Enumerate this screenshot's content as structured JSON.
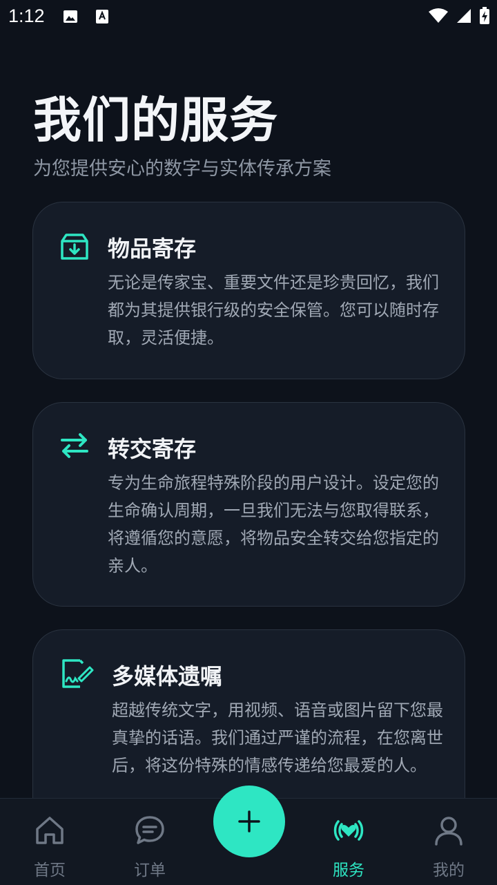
{
  "status": {
    "time": "1:12"
  },
  "page": {
    "title": "我们的服务",
    "subtitle": "为您提供安心的数字与实体传承方案"
  },
  "services": [
    {
      "title": "物品寄存",
      "body": "无论是传家宝、重要文件还是珍贵回忆，我们都为其提供银行级的安全保管。您可以随时存取，灵活便捷。",
      "icon": "archive-download-icon"
    },
    {
      "title": "转交寄存",
      "body": "专为生命旅程特殊阶段的用户设计。设定您的生命确认周期，一旦我们无法与您取得联系，将遵循您的意愿，将物品安全转交给您指定的亲人。",
      "icon": "transfer-arrows-icon"
    },
    {
      "title": "多媒体遗嘱",
      "body": "超越传统文字，用视频、语音或图片留下您最真挚的话语。我们通过严谨的流程，在您离世后，将这份特殊的情感传递给您最爱的人。",
      "icon": "signature-document-icon"
    }
  ],
  "nav": {
    "items": [
      {
        "label": "首页",
        "icon": "home-icon"
      },
      {
        "label": "订单",
        "icon": "chat-bubble-icon"
      },
      {
        "label": "服务",
        "icon": "heart-broadcast-icon",
        "active": true
      },
      {
        "label": "我的",
        "icon": "user-icon"
      }
    ],
    "fab_icon": "plus-icon"
  },
  "colors": {
    "background": "#0d121b",
    "card": "#151c28",
    "accent": "#2ee6c3",
    "muted": "#6f7886"
  }
}
